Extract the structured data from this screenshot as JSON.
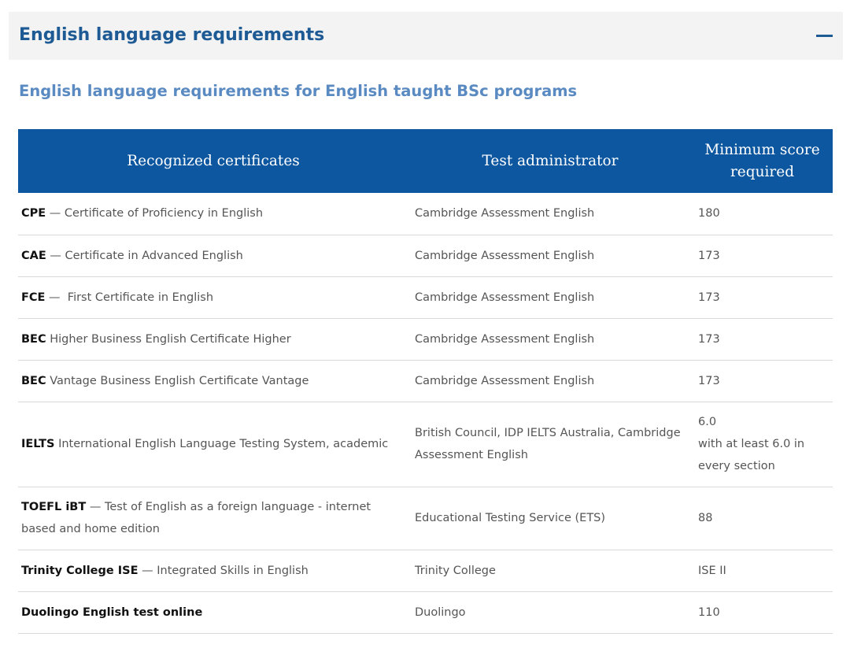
{
  "section": {
    "title": "English language requirements",
    "collapse_icon": "minus-icon"
  },
  "subtitle": "English language requirements for English taught BSc programs",
  "table": {
    "headers": [
      "Recognized certificates",
      "Test administrator",
      "Minimum score required"
    ],
    "rows": [
      {
        "abbr": "CPE",
        "desc": " — Certificate of Proficiency in English",
        "admin": "Cambridge Assessment English",
        "score": "180",
        "score_note": ""
      },
      {
        "abbr": "CAE",
        "desc": " — Certificate in Advanced English",
        "admin": "Cambridge Assessment English",
        "score": "173",
        "score_note": ""
      },
      {
        "abbr": "FCE",
        "desc": " —  First Certificate in English",
        "admin": "Cambridge Assessment English",
        "score": "173",
        "score_note": ""
      },
      {
        "abbr": "BEC",
        "desc": " Higher Business English Certificate Higher",
        "admin": "Cambridge Assessment English",
        "score": "173",
        "score_note": ""
      },
      {
        "abbr": "BEC",
        "desc": " Vantage Business English Certificate Vantage",
        "admin": "Cambridge Assessment English",
        "score": "173",
        "score_note": ""
      },
      {
        "abbr": "IELTS",
        "desc": " International English Language Testing System, academic",
        "admin": "British Council, IDP IELTS Australia, Cambridge Assessment English",
        "score": "6.0",
        "score_note": "with at least 6.0 in every section"
      },
      {
        "abbr": "TOEFL iBT",
        "desc": " — Test of English as a foreign language - internet based and home edition",
        "admin": "Educational Testing Service (ETS)",
        "score": "88",
        "score_note": ""
      },
      {
        "abbr": "Trinity College ISE",
        "desc": " — Integrated Skills in English",
        "admin": "Trinity College",
        "score": "ISE II",
        "score_note": ""
      },
      {
        "abbr": "Duolingo English test online",
        "desc": "",
        "admin": "Duolingo",
        "score": "110",
        "score_note": ""
      }
    ]
  }
}
